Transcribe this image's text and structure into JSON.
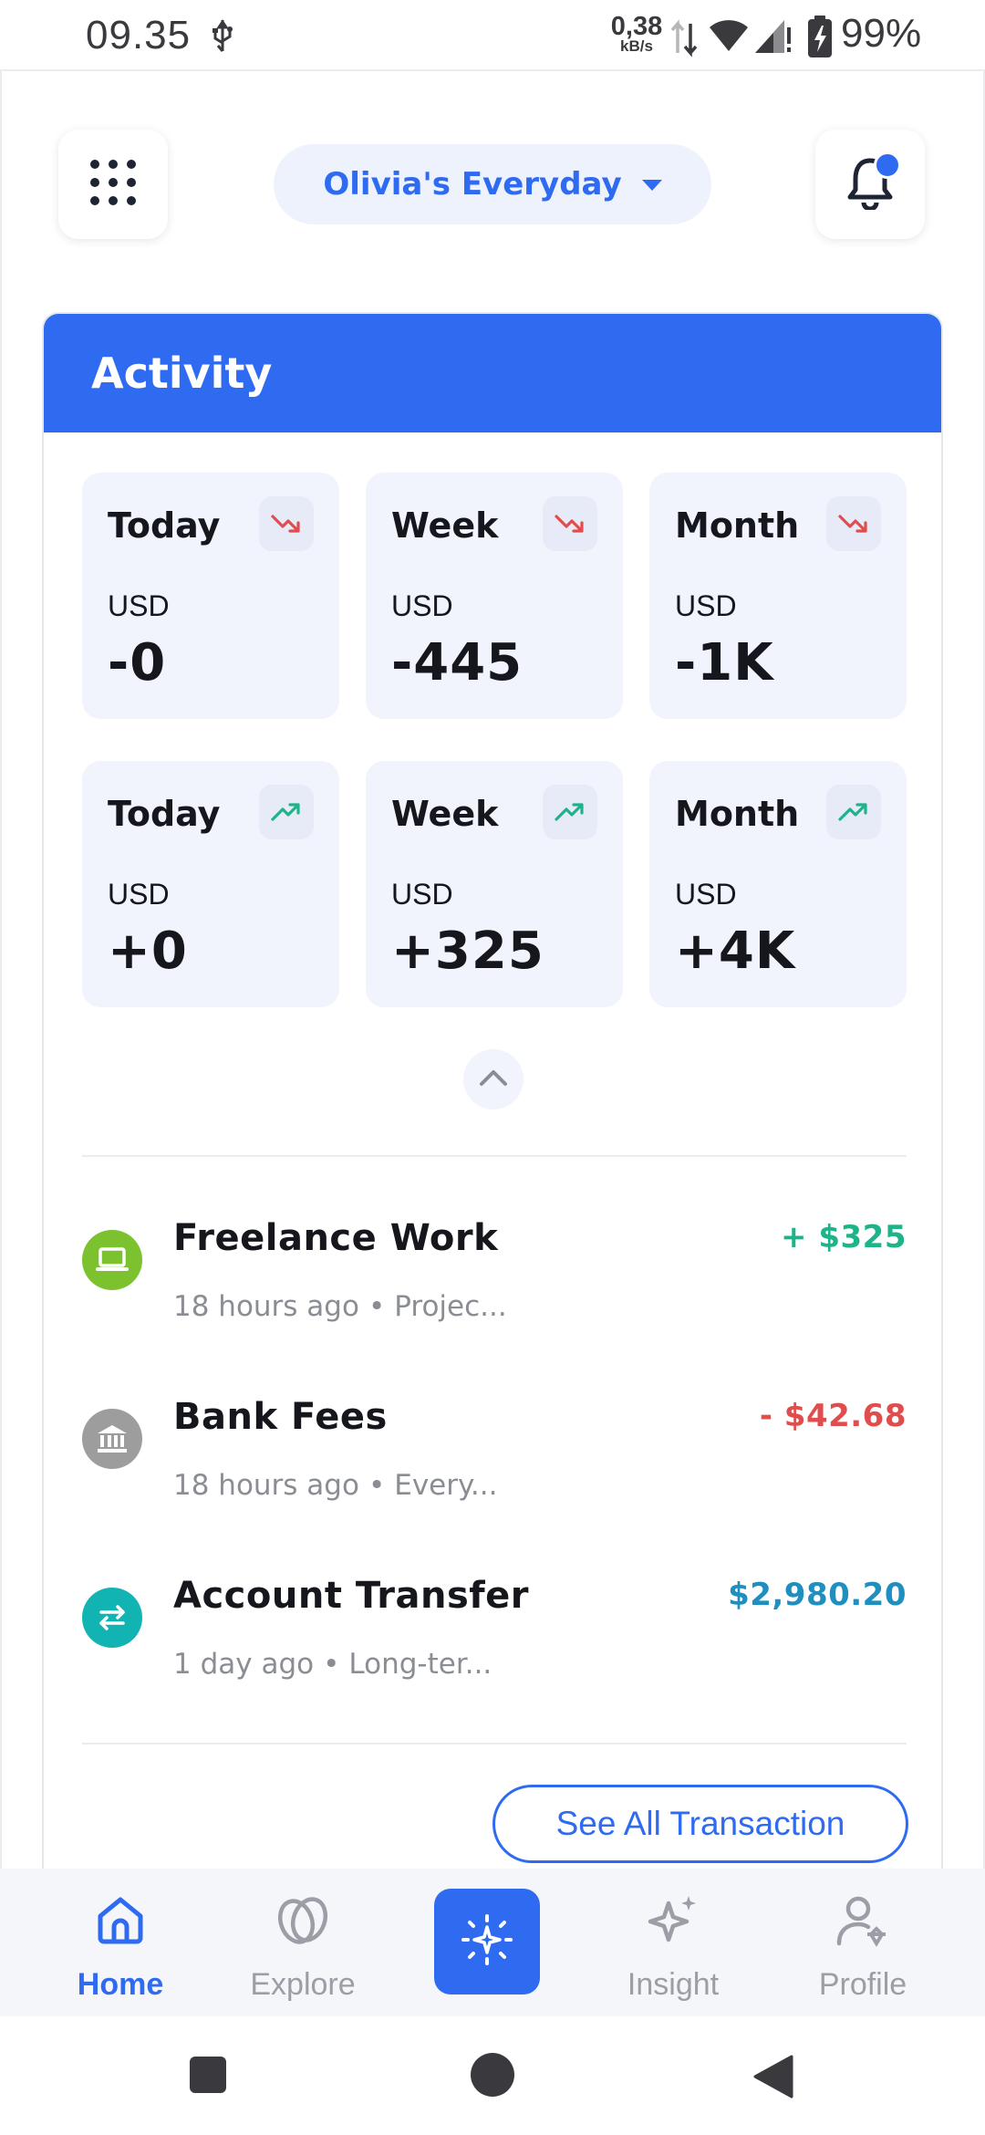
{
  "status_bar": {
    "time": "09.35",
    "net_speed_value": "0,38",
    "net_speed_unit": "kB/s",
    "battery": "99%"
  },
  "header": {
    "account_name": "Olivia's Everyday",
    "menu_icon": "grid-dots-icon",
    "notification_icon": "bell-icon"
  },
  "activity": {
    "title": "Activity",
    "stats": [
      {
        "label": "Today",
        "currency": "USD",
        "value": "-0",
        "trend": "down"
      },
      {
        "label": "Week",
        "currency": "USD",
        "value": "-445",
        "trend": "down"
      },
      {
        "label": "Month",
        "currency": "USD",
        "value": "-1K",
        "trend": "down"
      },
      {
        "label": "Today",
        "currency": "USD",
        "value": "+0",
        "trend": "up"
      },
      {
        "label": "Week",
        "currency": "USD",
        "value": "+325",
        "trend": "up"
      },
      {
        "label": "Month",
        "currency": "USD",
        "value": "+4K",
        "trend": "up"
      }
    ],
    "transactions": [
      {
        "name": "Freelance Work",
        "amount": "+ $325",
        "time": "18 hours ago",
        "category": "Projec...",
        "icon": "laptop-icon",
        "icon_color": "#7cc22f",
        "amount_color": "#1fb38a"
      },
      {
        "name": "Bank Fees",
        "amount": "- $42.68",
        "time": "18 hours ago",
        "category": "Every...",
        "icon": "bank-icon",
        "icon_color": "#9d9d9d",
        "amount_color": "#e14d4d"
      },
      {
        "name": "Account Transfer",
        "amount": "$2,980.20",
        "time": "1 day ago",
        "category": "Long-ter...",
        "icon": "transfer-icon",
        "icon_color": "#12b3b3",
        "amount_color": "#1f8fbf"
      }
    ],
    "see_all_label": "See All Transaction"
  },
  "bottom_nav": {
    "items": [
      {
        "label": "Home",
        "icon": "home-icon",
        "active": true
      },
      {
        "label": "Explore",
        "icon": "explore-icon",
        "active": false
      },
      {
        "label": "",
        "icon": "sparkle-burst-icon",
        "active": false
      },
      {
        "label": "Insight",
        "icon": "sparkle-icon",
        "active": false
      },
      {
        "label": "Profile",
        "icon": "profile-icon",
        "active": false
      }
    ]
  },
  "colors": {
    "accent": "#2f6bf1",
    "down_trend": "#e14d4d",
    "up_trend": "#1fb38a",
    "tile_bg": "#f1f4fd"
  }
}
